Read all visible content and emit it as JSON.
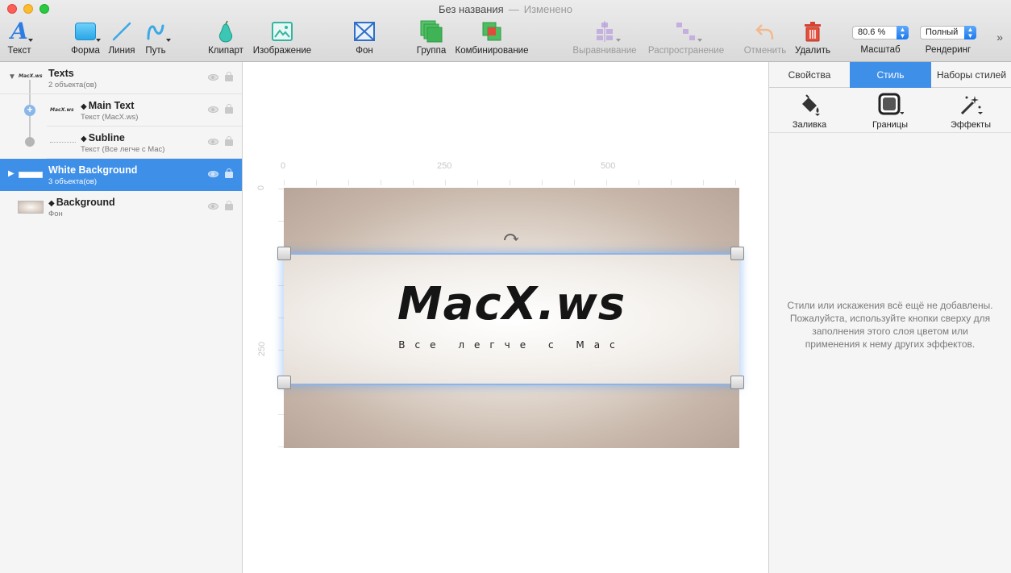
{
  "window": {
    "title": "Без названия",
    "separator": "—",
    "status": "Изменено"
  },
  "toolbar": {
    "text": "Текст",
    "shape": "Форма",
    "line": "Линия",
    "path": "Путь",
    "clipart": "Клипарт",
    "image": "Изображение",
    "background": "Фон",
    "group": "Группа",
    "combine": "Комбинирование",
    "align": "Выравнивание",
    "distribute": "Распространение",
    "undo": "Отменить",
    "delete": "Удалить",
    "zoom_value": "80.6 %",
    "zoom_label": "Масштаб",
    "render_value": "Полный",
    "render_label": "Рендеринг"
  },
  "layers": [
    {
      "name": "Texts",
      "sub": "2 объекта(ов)"
    },
    {
      "name": "Main Text",
      "sub": "Текст (MacX.ws)"
    },
    {
      "name": "Subline",
      "sub": "Текст (Все легче с Mac)"
    },
    {
      "name": "White Background",
      "sub": "3 объекта(ов)"
    },
    {
      "name": "Background",
      "sub": "Фон"
    }
  ],
  "canvas": {
    "ruler_top": [
      "0",
      "250",
      "500"
    ],
    "ruler_left": [
      "0",
      "250"
    ],
    "main_text": "MacX.ws",
    "sub_text": "Все легче с Mac"
  },
  "inspector": {
    "tabs": [
      "Свойства",
      "Стиль",
      "Наборы стилей"
    ],
    "active_tab": "Стиль",
    "tools": {
      "fill": "Заливка",
      "borders": "Границы",
      "effects": "Эффекты"
    },
    "message": "Стили или искажения всё ещё не добавлены. Пожалуйста, используйте кнопки сверху для заполнения этого слоя цветом или применения к нему других эффектов."
  },
  "colors": {
    "accent": "#3e8fe8",
    "selection": "#8cb4e8",
    "close": "#fc5f57",
    "minimize": "#fdbc2e",
    "zoom": "#29c940"
  }
}
